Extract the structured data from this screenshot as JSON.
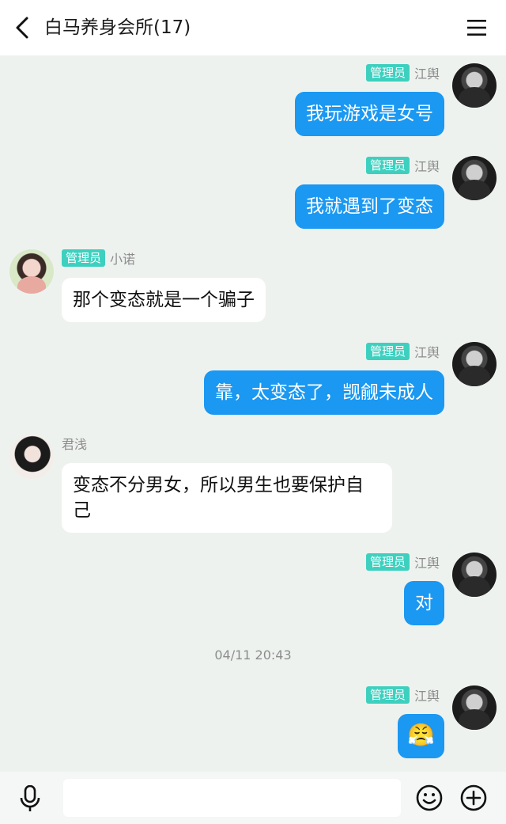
{
  "header": {
    "title": "白马养身会所(17)"
  },
  "icons": {
    "back": "chevron-left-icon",
    "menu": "hamburger-menu-icon",
    "mic": "microphone-icon",
    "emoji": "smiley-icon",
    "plus": "plus-circle-icon"
  },
  "messages": [
    {
      "side": "right",
      "badge": "管理员",
      "nick": "江舆",
      "text": "我玩游戏是女号"
    },
    {
      "side": "right",
      "badge": "管理员",
      "nick": "江舆",
      "text": "我就遇到了变态"
    },
    {
      "side": "left",
      "badge": "管理员",
      "nick": "小诺",
      "text": "那个变态就是一个骗子"
    },
    {
      "side": "right",
      "badge": "管理员",
      "nick": "江舆",
      "text": "靠，太变态了，觊觎未成人"
    },
    {
      "side": "left",
      "badge": "",
      "nick": "君浅",
      "text": "变态不分男女，所以男生也要保护自己"
    },
    {
      "side": "right",
      "badge": "管理员",
      "nick": "江舆",
      "text": "对"
    },
    {
      "side": "right",
      "badge": "管理员",
      "nick": "江舆",
      "text": "😤"
    }
  ],
  "timestamp": "04/11 20:43",
  "composer": {
    "value": "",
    "placeholder": ""
  },
  "colors": {
    "accent": "#1a98f2",
    "badge": "#3ed0bf",
    "background": "#eef2ef"
  }
}
